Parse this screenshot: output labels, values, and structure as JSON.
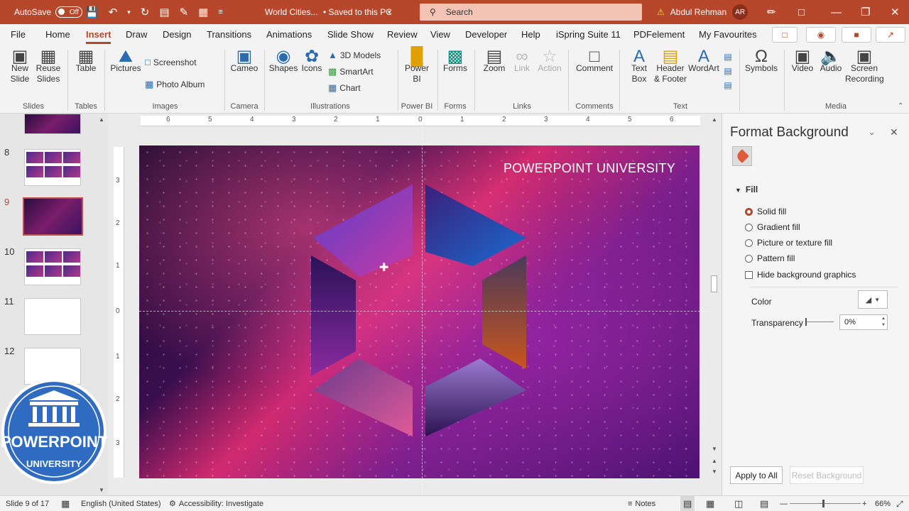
{
  "titlebar": {
    "autosave_label": "AutoSave",
    "autosave_state": "Off",
    "file_name": "World Cities...",
    "save_status": "• Saved to this PC",
    "search_placeholder": "Search",
    "user_name": "Abdul Rehman",
    "user_initials": "AR"
  },
  "tabs": [
    "File",
    "Home",
    "Insert",
    "Draw",
    "Design",
    "Transitions",
    "Animations",
    "Slide Show",
    "Review",
    "View",
    "Developer",
    "Help",
    "iSpring Suite 11",
    "PDFelement",
    "My Favourites"
  ],
  "active_tab": "Insert",
  "ribbon": {
    "slides": {
      "new_slide": "New",
      "new_slide_2": "Slide",
      "reuse": "Reuse",
      "reuse_2": "Slides",
      "group": "Slides"
    },
    "tables": {
      "table": "Table",
      "group": "Tables"
    },
    "images": {
      "pictures": "Pictures",
      "screenshot": "Screenshot",
      "photo_album": "Photo Album",
      "group": "Images"
    },
    "camera": {
      "cameo": "Cameo",
      "group": "Camera"
    },
    "illustrations": {
      "shapes": "Shapes",
      "icons": "Icons",
      "models": "3D Models",
      "smartart": "SmartArt",
      "chart": "Chart",
      "group": "Illustrations"
    },
    "powerbi": {
      "power": "Power",
      "bi": "BI",
      "group": "Power BI"
    },
    "forms": {
      "forms": "Forms",
      "group": "Forms"
    },
    "links": {
      "zoom": "Zoom",
      "link": "Link",
      "action": "Action",
      "group": "Links"
    },
    "comments": {
      "comment": "Comment",
      "group": "Comments"
    },
    "text": {
      "textbox": "Text",
      "textbox_2": "Box",
      "header": "Header",
      "header_2": "& Footer",
      "wordart": "WordArt",
      "group": "Text"
    },
    "symbols": {
      "symbols": "Symbols"
    },
    "media": {
      "video": "Video",
      "audio": "Audio",
      "screen": "Screen",
      "recording": "Recording",
      "group": "Media"
    }
  },
  "thumbnails": {
    "numbers": [
      "8",
      "9",
      "10",
      "11",
      "12"
    ],
    "selected": "9"
  },
  "slide": {
    "title": "POWERPOINT UNIVERSITY"
  },
  "rulers": {
    "h": [
      "6",
      "5",
      "4",
      "3",
      "2",
      "1",
      "0",
      "1",
      "2",
      "3",
      "4",
      "5",
      "6"
    ],
    "v": [
      "3",
      "2",
      "1",
      "0",
      "1",
      "2",
      "3"
    ]
  },
  "pane": {
    "title": "Format Background",
    "section": "Fill",
    "options": [
      "Solid fill",
      "Gradient fill",
      "Picture or texture fill",
      "Pattern fill"
    ],
    "hide_graphics": "Hide background graphics",
    "color_label": "Color",
    "transparency_label": "Transparency",
    "transparency_value": "0%",
    "apply_all": "Apply to All",
    "reset": "Reset Background"
  },
  "logo": {
    "text_main": "POWERPOINT",
    "text_sub": "UNIVERSITY"
  },
  "status": {
    "slide_info": "Slide 9 of 17",
    "language": "English (United States)",
    "accessibility": "Accessibility: Investigate",
    "notes": "Notes",
    "zoom": "66%"
  },
  "colors": {
    "accent": "#b7472a",
    "slide_magenta": "#d12a6f",
    "slide_purple": "#4b1270"
  }
}
